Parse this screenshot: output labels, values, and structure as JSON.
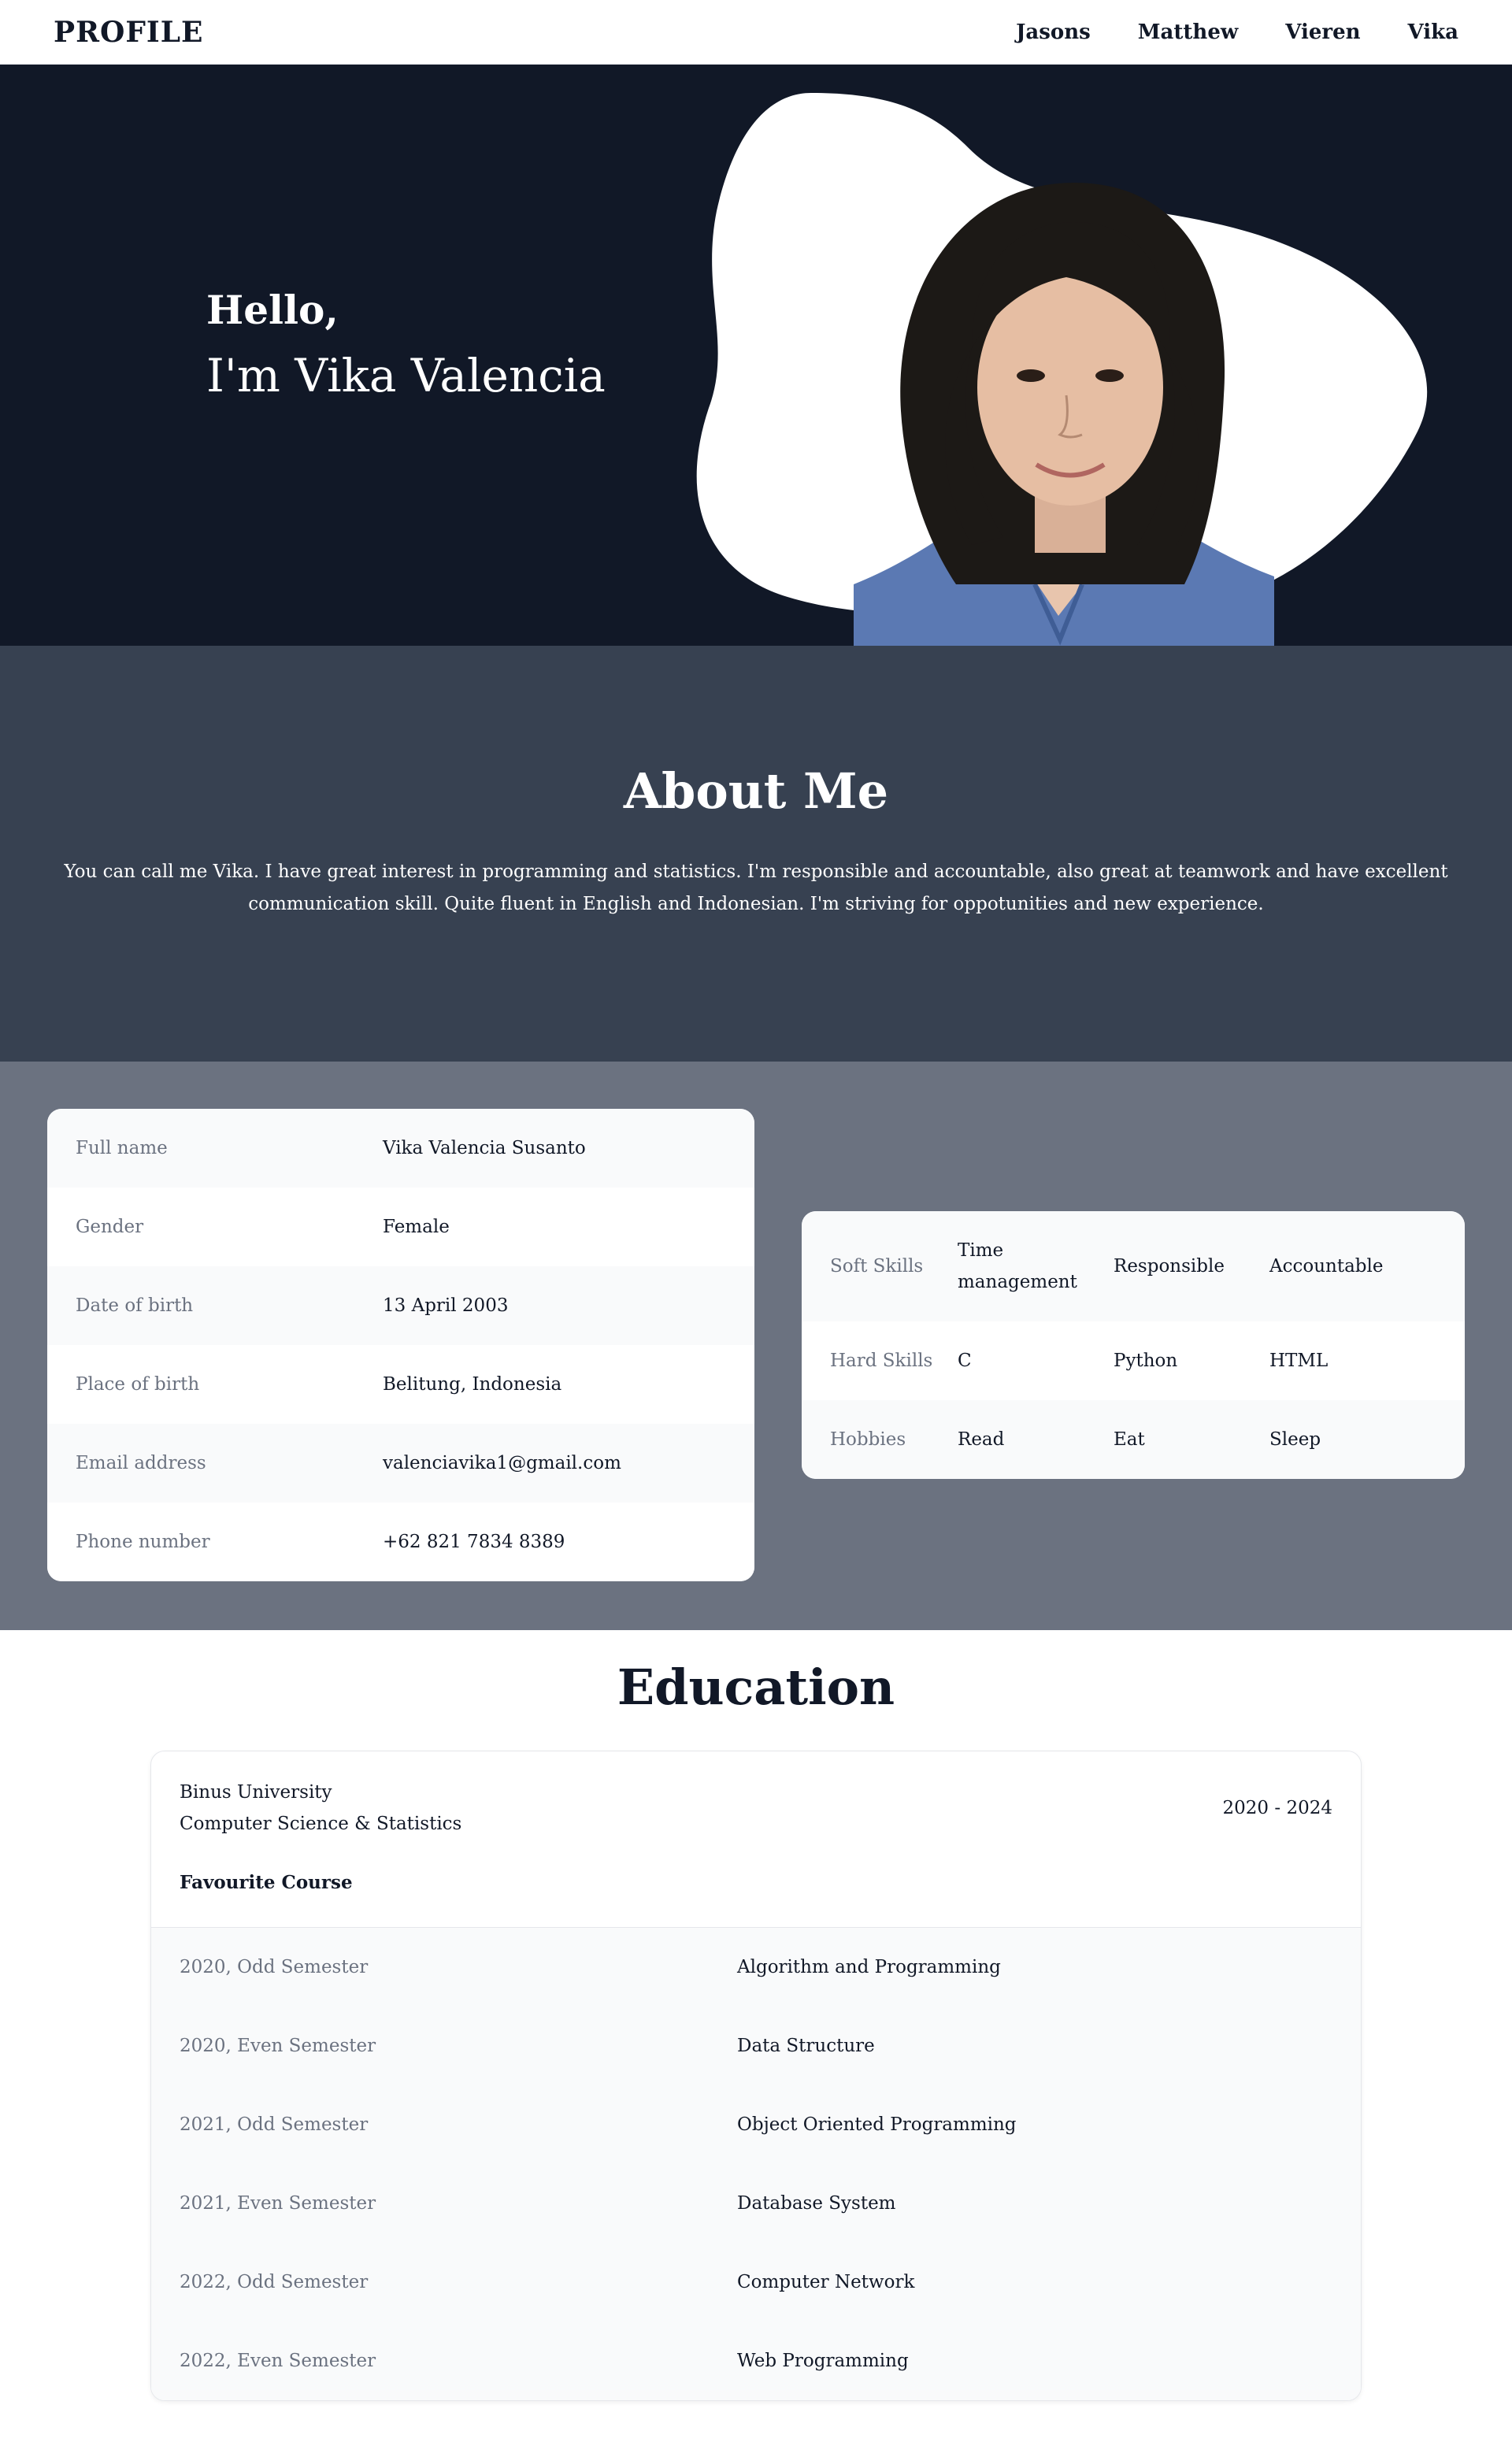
{
  "header": {
    "brand": "PROFILE",
    "nav": [
      "Jasons",
      "Matthew",
      "Vieren",
      "Vika"
    ]
  },
  "hero": {
    "greeting": "Hello,",
    "name": "I'm Vika Valencia"
  },
  "about": {
    "title": "About Me",
    "text": "You can call me Vika. I have great interest in programming and statistics. I'm responsible and accountable, also great at teamwork and have excellent communication skill. Quite fluent in English and Indonesian. I'm striving for oppotunities and new experience."
  },
  "personal": [
    {
      "label": "Full name",
      "value": "Vika Valencia Susanto"
    },
    {
      "label": "Gender",
      "value": "Female"
    },
    {
      "label": "Date of birth",
      "value": "13 April 2003"
    },
    {
      "label": "Place of birth",
      "value": "Belitung, Indonesia"
    },
    {
      "label": "Email address",
      "value": "valenciavika1@gmail.com"
    },
    {
      "label": "Phone number",
      "value": "+62 821 7834 8389"
    }
  ],
  "skills": [
    {
      "label": "Soft Skills",
      "values": [
        "Time management",
        "Responsible",
        "Accountable"
      ]
    },
    {
      "label": "Hard Skills",
      "values": [
        "C",
        "Python",
        "HTML"
      ]
    },
    {
      "label": "Hobbies",
      "values": [
        "Read",
        "Eat",
        "Sleep"
      ]
    }
  ],
  "education": {
    "title": "Education",
    "school": "Binus University",
    "major": "Computer Science & Statistics",
    "years": "2020 - 2024",
    "favourite_title": "Favourite Course",
    "courses": [
      {
        "semester": "2020, Odd Semester",
        "course": "Algorithm and Programming"
      },
      {
        "semester": "2020, Even Semester",
        "course": "Data Structure"
      },
      {
        "semester": "2021, Odd Semester",
        "course": "Object Oriented Programming"
      },
      {
        "semester": "2021, Even Semester",
        "course": "Database System"
      },
      {
        "semester": "2022, Odd Semester",
        "course": "Computer Network"
      },
      {
        "semester": "2022, Even Semester",
        "course": "Web Programming"
      }
    ]
  },
  "colors": {
    "navy": "#111827",
    "slate": "#374151",
    "gray": "#6b7280",
    "white": "#ffffff"
  }
}
